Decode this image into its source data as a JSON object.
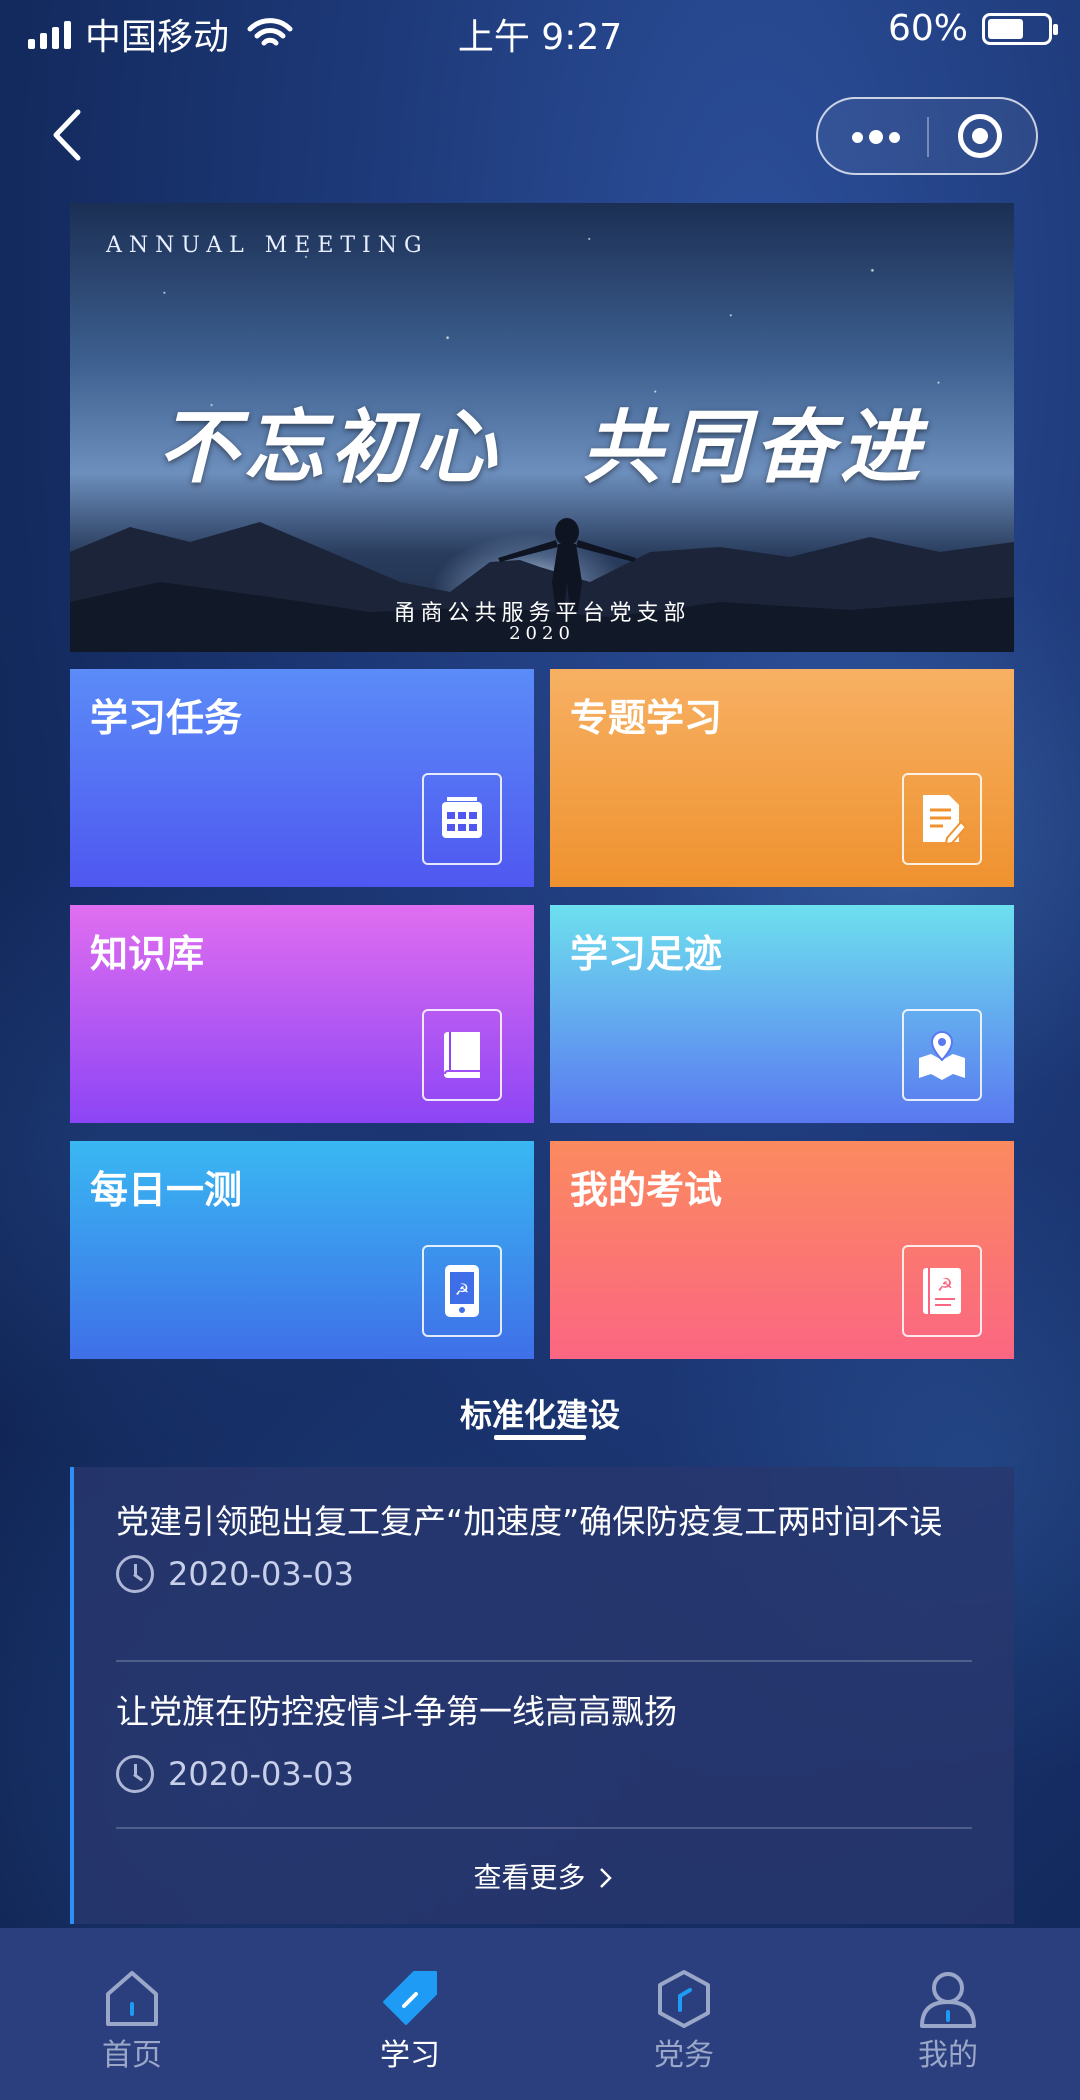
{
  "status_bar": {
    "carrier": "中国移动",
    "time": "上午 9:27",
    "battery_percent": "60%",
    "battery_level": 0.6
  },
  "nav": {
    "back_icon": "chevron-left-icon",
    "more_icon": "more-dots-icon",
    "close_icon": "target-close-icon"
  },
  "banner": {
    "small_caption": "ANNUAL MEETING",
    "title_left": "不忘初心",
    "title_right": "共同奋进",
    "organization": "甬商公共服务平台党支部",
    "year": "2020"
  },
  "tiles": [
    {
      "label": "学习任务",
      "icon": "calendar-icon",
      "color": "#5b8cf8"
    },
    {
      "label": "专题学习",
      "icon": "document-edit-icon",
      "color": "#f7b063"
    },
    {
      "label": "知识库",
      "icon": "book-icon",
      "color": "#c15df2"
    },
    {
      "label": "学习足迹",
      "icon": "map-location-icon",
      "color": "#6de0ee"
    },
    {
      "label": "每日一测",
      "icon": "phone-party-emblem-icon",
      "color": "#39b8f2"
    },
    {
      "label": "我的考试",
      "icon": "party-book-icon",
      "color": "#fb7a70"
    }
  ],
  "section": {
    "title": "标准化建设"
  },
  "news": [
    {
      "title": "党建引领跑出复工复产“加速度”确保防疫复工两时间不误",
      "date": "2020-03-03"
    },
    {
      "title": "让党旗在防控疫情斗争第一线高高飘扬",
      "date": "2020-03-03"
    }
  ],
  "more_link": "查看更多",
  "tabbar": [
    {
      "label": "首页",
      "icon": "home-icon",
      "active": false
    },
    {
      "label": "学习",
      "icon": "tag-icon",
      "active": true
    },
    {
      "label": "党务",
      "icon": "hexagon-icon",
      "active": false
    },
    {
      "label": "我的",
      "icon": "user-icon",
      "active": false
    }
  ],
  "colors": {
    "accent": "#2f8ff6",
    "tabbar_bg": "#2b3f7e",
    "active_tab_icon": "#1e9bf5"
  }
}
